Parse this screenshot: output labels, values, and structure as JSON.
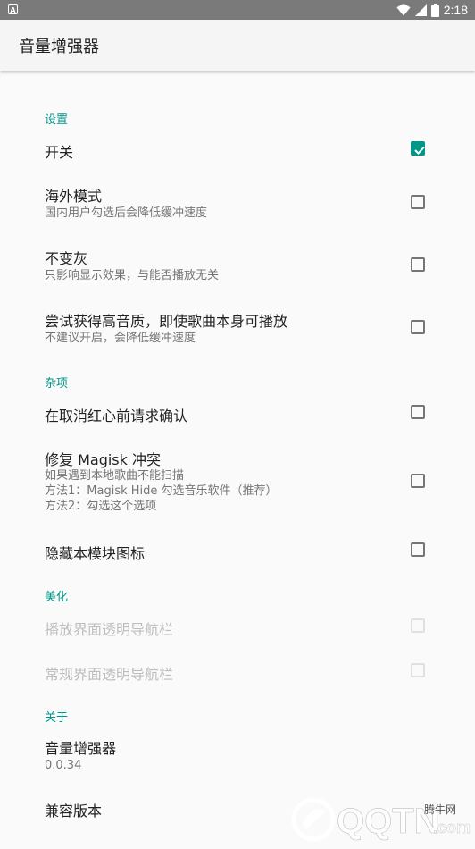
{
  "status_bar": {
    "time": "2:18",
    "app_badge": "A"
  },
  "app_bar": {
    "title": "音量增强器"
  },
  "sections": {
    "settings": {
      "header": "设置"
    },
    "misc": {
      "header": "杂项"
    },
    "beautify": {
      "header": "美化"
    },
    "about": {
      "header": "关于"
    }
  },
  "prefs": {
    "switch": {
      "title": "开关",
      "checked": true
    },
    "overseas": {
      "title": "海外模式",
      "summary": "国内用户勾选后会降低缓冲速度",
      "checked": false
    },
    "no_gray": {
      "title": "不变灰",
      "summary": "只影响显示效果，与能否播放无关",
      "checked": false
    },
    "high_quality": {
      "title": "尝试获得高音质，即使歌曲本身可播放",
      "summary": "不建议开启，会降低缓冲速度",
      "checked": false
    },
    "confirm_unlike": {
      "title": "在取消红心前请求确认",
      "checked": false
    },
    "magisk_fix": {
      "title": "修复 Magisk 冲突",
      "summary_line1": "如果遇到本地歌曲不能扫描",
      "summary_line2": "方法1：Magisk Hide 勾选音乐软件（推荐）",
      "summary_line3": "方法2：勾选这个选项",
      "checked": false
    },
    "hide_icon": {
      "title": "隐藏本模块图标",
      "checked": false
    },
    "player_nav": {
      "title": "播放界面透明导航栏",
      "checked": false,
      "enabled": false
    },
    "normal_nav": {
      "title": "常规界面透明导航栏",
      "checked": false,
      "enabled": false
    },
    "app_info": {
      "title": "音量增强器",
      "summary": "0.0.34"
    },
    "compat": {
      "title": "兼容版本"
    }
  },
  "watermark": {
    "brand": "QQTN",
    "suffix": ".com",
    "site_name": "腾牛网"
  },
  "colors": {
    "accent": "#009688",
    "status_bar": "#7a7a7a",
    "app_bar": "#f5f5f5",
    "background": "#fafafa"
  }
}
